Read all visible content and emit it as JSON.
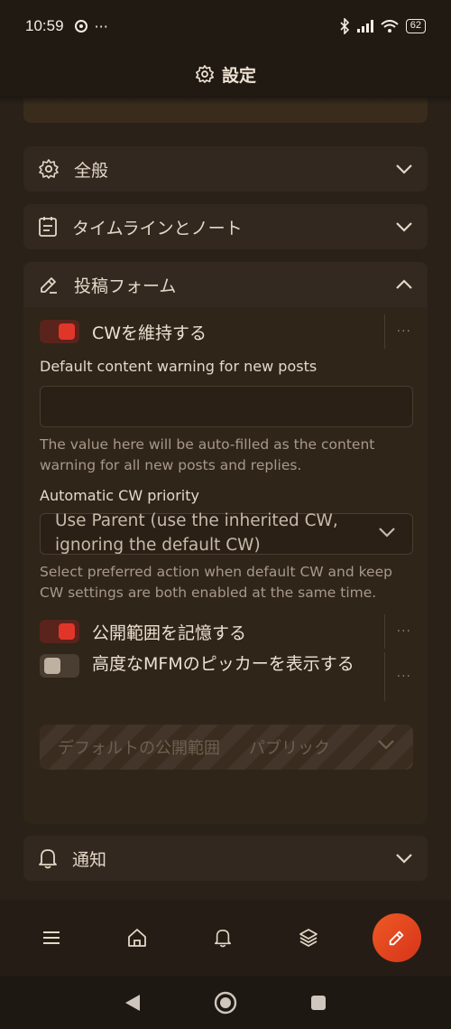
{
  "status_bar": {
    "time": "10:59",
    "dots": "···",
    "battery": "62"
  },
  "header": {
    "title": "設定"
  },
  "sections": {
    "general": "全般",
    "timeline": "タイムラインとノート",
    "post_form": "投稿フォーム",
    "notifications": "通知"
  },
  "post_form": {
    "keep_cw_label": "CWを維持する",
    "default_cw_label": "Default content warning for new posts",
    "default_cw_value": "",
    "default_cw_caption": "The value here will be auto-filled as the content warning for all new posts and replies.",
    "priority_label": "Automatic CW priority",
    "priority_value": "Use Parent (use the inherited CW, ignoring the default CW)",
    "priority_caption": "Select preferred action when default CW and keep CW settings are both enabled at the same time.",
    "remember_visibility_label": "公開範囲を記憶する",
    "mfm_picker_label": "高度なMFMのピッカーを表示する",
    "default_visibility_label": "デフォルトの公開範囲",
    "default_visibility_value": "パブリック",
    "more_glyph": "···"
  },
  "toggles": {
    "keep_cw": true,
    "remember_visibility": true,
    "mfm_picker": false
  },
  "colors": {
    "accent": "#e0362a",
    "fab": "#e8481f"
  }
}
